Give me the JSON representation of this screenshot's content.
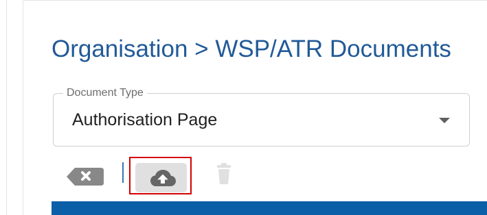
{
  "page": {
    "title": "Organisation > WSP/ATR Documents"
  },
  "document_type": {
    "label": "Document Type",
    "value": "Authorisation Page"
  },
  "toolbar": {
    "clear_icon": "backspace-x-icon",
    "upload_icon": "cloud-upload-icon",
    "delete_icon": "trash-icon"
  },
  "colors": {
    "title": "#215a97",
    "highlight_box": "#d40000",
    "upload_button_bg": "#e0e0e0",
    "bottom_bar": "#0b5ea8"
  }
}
